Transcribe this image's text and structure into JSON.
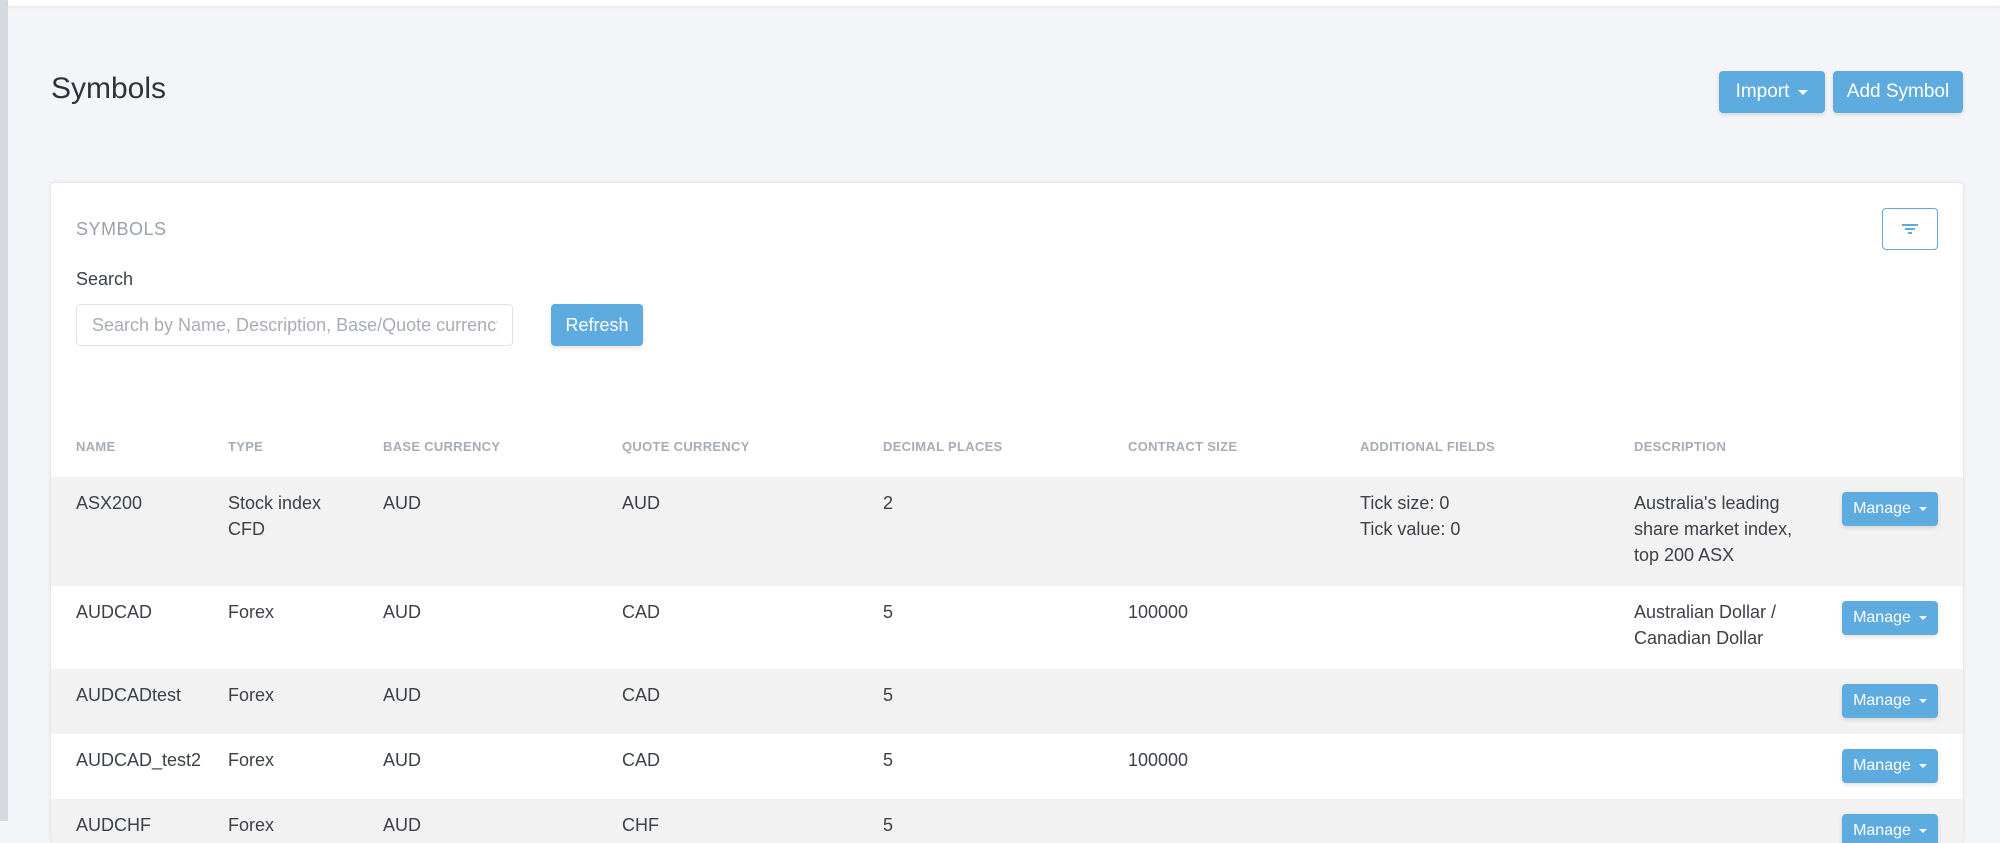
{
  "page": {
    "title": "Symbols"
  },
  "header": {
    "import_label": "Import",
    "add_symbol_label": "Add Symbol"
  },
  "card": {
    "heading": "SYMBOLS",
    "filter_icon": "filter-icon",
    "search_label": "Search",
    "search_placeholder": "Search by Name, Description, Base/Quote currency",
    "search_value": "",
    "refresh_label": "Refresh"
  },
  "table": {
    "columns": [
      "NAME",
      "TYPE",
      "BASE CURRENCY",
      "QUOTE CURRENCY",
      "DECIMAL PLACES",
      "CONTRACT SIZE",
      "ADDITIONAL FIELDS",
      "DESCRIPTION"
    ],
    "manage_label": "Manage",
    "rows": [
      {
        "name": "ASX200",
        "type": "Stock index CFD",
        "base": "AUD",
        "quote": "AUD",
        "decimals": "2",
        "contract_size": "",
        "additional_fields": [
          "Tick size: 0",
          "Tick value: 0"
        ],
        "description": "Australia's leading share market index, top 200 ASX"
      },
      {
        "name": "AUDCAD",
        "type": "Forex",
        "base": "AUD",
        "quote": "CAD",
        "decimals": "5",
        "contract_size": "100000",
        "additional_fields": [],
        "description": "Australian Dollar / Canadian Dollar"
      },
      {
        "name": "AUDCADtest",
        "type": "Forex",
        "base": "AUD",
        "quote": "CAD",
        "decimals": "5",
        "contract_size": "",
        "additional_fields": [],
        "description": ""
      },
      {
        "name": "AUDCAD_test2",
        "type": "Forex",
        "base": "AUD",
        "quote": "CAD",
        "decimals": "5",
        "contract_size": "100000",
        "additional_fields": [],
        "description": ""
      },
      {
        "name": "AUDCHF",
        "type": "Forex",
        "base": "AUD",
        "quote": "CHF",
        "decimals": "5",
        "contract_size": "",
        "additional_fields": [],
        "description": ""
      }
    ]
  },
  "colors": {
    "accent": "#5eabe0",
    "row_stripe": "#f2f2f2",
    "page_bg": "#f4f5f8"
  }
}
